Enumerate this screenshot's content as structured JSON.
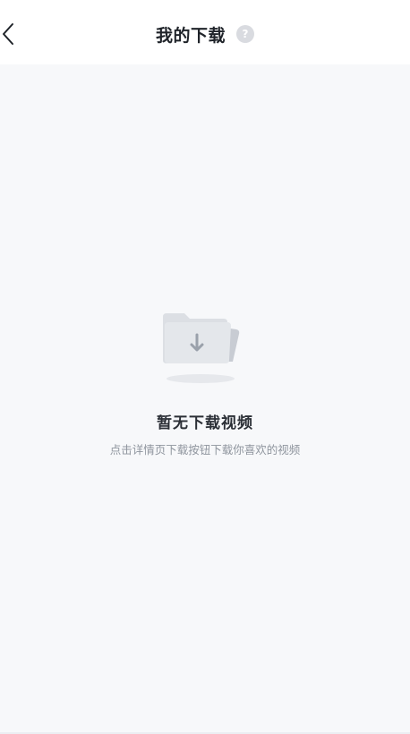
{
  "header": {
    "title": "我的下载",
    "help_glyph": "?",
    "back_icon": "chevron-left-icon",
    "help_icon": "question-circle-icon"
  },
  "empty_state": {
    "title": "暂无下载视频",
    "subtitle": "点击详情页下载按钮下载你喜欢的视频",
    "icon": "folder-download-icon"
  }
}
